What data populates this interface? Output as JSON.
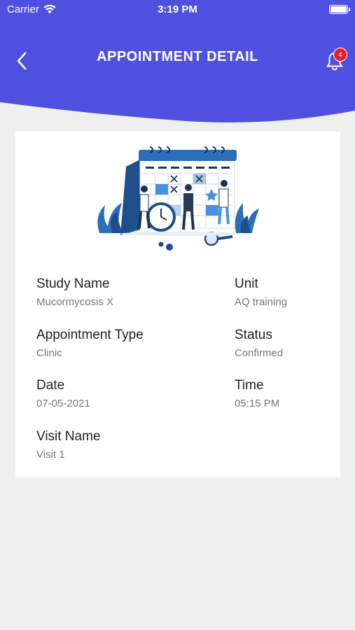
{
  "status_bar": {
    "carrier": "Carrier",
    "time": "3:19 PM"
  },
  "header": {
    "title": "APPOINTMENT DETAIL",
    "notification_count": "4",
    "bg_color": "#5050e0"
  },
  "details": {
    "study_name": {
      "label": "Study Name",
      "value": "Mucormycosis X"
    },
    "unit": {
      "label": "Unit",
      "value": "AQ training"
    },
    "appointment_type": {
      "label": "Appointment Type",
      "value": "Clinic"
    },
    "status": {
      "label": "Status",
      "value": "Confirmed"
    },
    "date": {
      "label": "Date",
      "value": "07-05-2021"
    },
    "time": {
      "label": "Time",
      "value": "05:15 PM"
    },
    "visit_name": {
      "label": "Visit Name",
      "value": "Visit 1"
    }
  },
  "icons": [
    "wifi-icon",
    "battery-icon",
    "back-arrow-icon",
    "bell-icon",
    "calendar-illustration"
  ]
}
